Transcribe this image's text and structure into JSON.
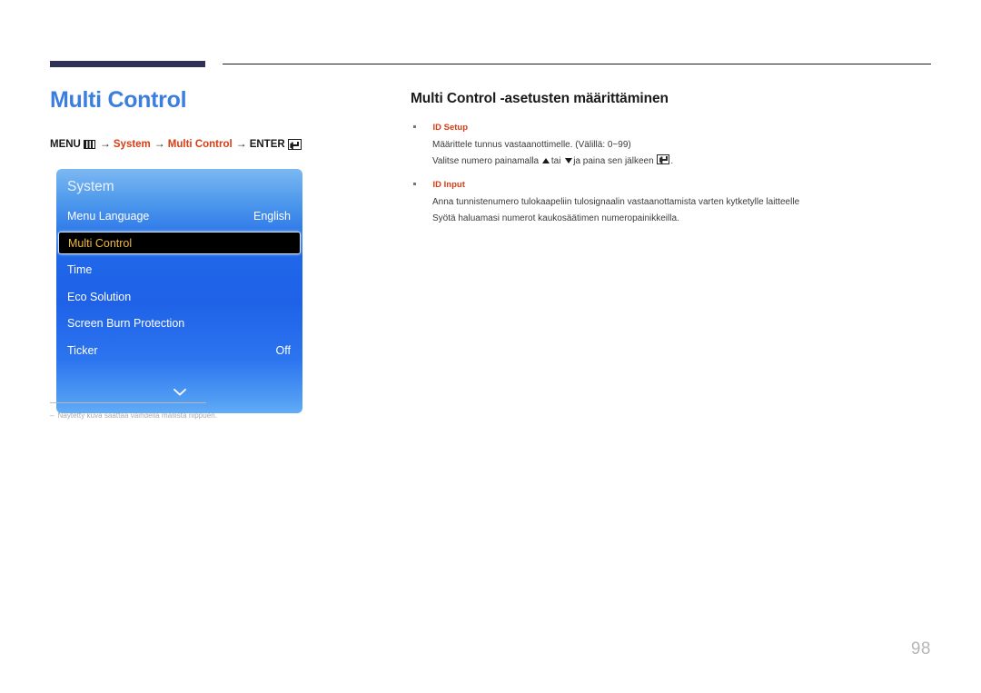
{
  "page": {
    "number": "98",
    "title": "Multi Control",
    "title_color": "#3b7ee0"
  },
  "breadcrumb": {
    "menu_label": "MENU",
    "menu_icon": "menu-grid-icon",
    "arrow": "→",
    "step1": "System",
    "step2": "Multi Control",
    "enter_label": "ENTER",
    "enter_icon": "enter-key-icon",
    "accent_color": "#d93b12"
  },
  "osd": {
    "header": "System",
    "rows": [
      {
        "label": "Menu Language",
        "value": "English",
        "selected": false
      },
      {
        "label": "Multi Control",
        "value": "",
        "selected": true
      },
      {
        "label": "Time",
        "value": "",
        "selected": false
      },
      {
        "label": "Eco Solution",
        "value": "",
        "selected": false
      },
      {
        "label": "Screen Burn Protection",
        "value": "",
        "selected": false
      },
      {
        "label": "Ticker",
        "value": "Off",
        "selected": false
      }
    ],
    "more_icon": "chevron-down-icon",
    "highlight_text_color": "#f2b83c",
    "panel_color": "#1f67e8"
  },
  "footnote": {
    "dash": "‒",
    "text": "Näytetty kuva saattaa vaihdella mallista riippuen."
  },
  "content": {
    "section_title": "Multi Control -asetusten määrittäminen",
    "bullets": [
      {
        "heading": "ID Setup",
        "lines": [
          {
            "before": "Määrittele tunnus vastaanottimelle. (Välillä: 0~99)",
            "after": ""
          },
          {
            "before": "Valitse numero painamalla",
            "mid": "tai",
            "mid2": "ja paina sen jälkeen",
            "after": "."
          }
        ]
      },
      {
        "heading": "ID Input",
        "lines": [
          {
            "before": "Anna tunnistenumero tulokaapeliin tulosignaalin vastaanottamista varten kytketylle laitteelle",
            "after": ""
          },
          {
            "before": "Syötä haluamasi numerot kaukosäätimen numeropainikkeilla.",
            "after": ""
          }
        ]
      }
    ]
  }
}
